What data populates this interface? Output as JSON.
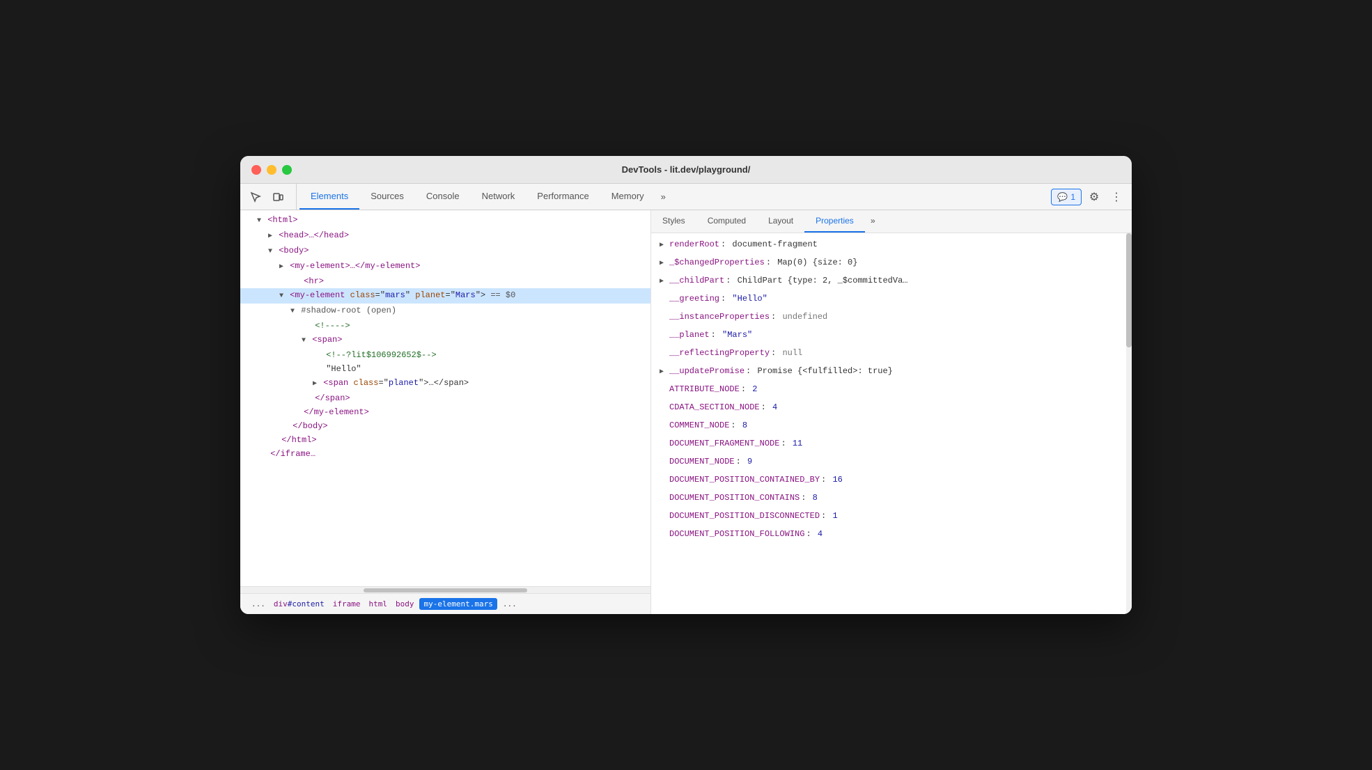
{
  "window": {
    "title": "DevTools - lit.dev/playground/"
  },
  "toolbar": {
    "tabs": [
      {
        "id": "elements",
        "label": "Elements",
        "active": true
      },
      {
        "id": "sources",
        "label": "Sources",
        "active": false
      },
      {
        "id": "console",
        "label": "Console",
        "active": false
      },
      {
        "id": "network",
        "label": "Network",
        "active": false
      },
      {
        "id": "performance",
        "label": "Performance",
        "active": false
      },
      {
        "id": "memory",
        "label": "Memory",
        "active": false
      }
    ],
    "more_tabs_icon": "»",
    "badge_icon": "💬",
    "badge_count": "1",
    "settings_icon": "⚙",
    "menu_icon": "⋮"
  },
  "props_panel": {
    "tabs": [
      {
        "id": "styles",
        "label": "Styles",
        "active": false
      },
      {
        "id": "computed",
        "label": "Computed",
        "active": false
      },
      {
        "id": "layout",
        "label": "Layout",
        "active": false
      },
      {
        "id": "properties",
        "label": "Properties",
        "active": true
      }
    ],
    "more_icon": "»",
    "properties": [
      {
        "expand": "▶",
        "key": "renderRoot",
        "colon": ":",
        "value": "document-fragment",
        "value_type": "object"
      },
      {
        "expand": "▶",
        "key": "_$changedProperties",
        "colon": ":",
        "value": "Map(0) {size: 0}",
        "value_type": "object"
      },
      {
        "expand": "▶",
        "key": "__childPart",
        "colon": ":",
        "value": "ChildPart {type: 2, _$committedVa…",
        "value_type": "object"
      },
      {
        "expand": "",
        "key": "__greeting",
        "colon": ":",
        "value": "\"Hello\"",
        "value_type": "string"
      },
      {
        "expand": "",
        "key": "__instanceProperties",
        "colon": ":",
        "value": "undefined",
        "value_type": "keyword"
      },
      {
        "expand": "",
        "key": "__planet",
        "colon": ":",
        "value": "\"Mars\"",
        "value_type": "string"
      },
      {
        "expand": "",
        "key": "__reflectingProperty",
        "colon": ":",
        "value": "null",
        "value_type": "null"
      },
      {
        "expand": "▶",
        "key": "__updatePromise",
        "colon": ":",
        "value": "Promise {<fulfilled>: true}",
        "value_type": "object"
      },
      {
        "expand": "",
        "key": "ATTRIBUTE_NODE",
        "colon": ":",
        "value": "2",
        "value_type": "number"
      },
      {
        "expand": "",
        "key": "CDATA_SECTION_NODE",
        "colon": ":",
        "value": "4",
        "value_type": "number"
      },
      {
        "expand": "",
        "key": "COMMENT_NODE",
        "colon": ":",
        "value": "8",
        "value_type": "number"
      },
      {
        "expand": "",
        "key": "DOCUMENT_FRAGMENT_NODE",
        "colon": ":",
        "value": "11",
        "value_type": "number"
      },
      {
        "expand": "",
        "key": "DOCUMENT_NODE",
        "colon": ":",
        "value": "9",
        "value_type": "number"
      },
      {
        "expand": "",
        "key": "DOCUMENT_POSITION_CONTAINED_BY",
        "colon": ":",
        "value": "16",
        "value_type": "number"
      },
      {
        "expand": "",
        "key": "DOCUMENT_POSITION_CONTAINS",
        "colon": ":",
        "value": "8",
        "value_type": "number"
      },
      {
        "expand": "",
        "key": "DOCUMENT_POSITION_DISCONNECTED",
        "colon": ":",
        "value": "1",
        "value_type": "number"
      },
      {
        "expand": "",
        "key": "DOCUMENT_POSITION_FOLLOWING",
        "colon": ":",
        "value": "4",
        "value_type": "number"
      }
    ]
  },
  "dom_tree": {
    "lines": [
      {
        "indent": 1,
        "content": "▼ <html>",
        "type": "tag"
      },
      {
        "indent": 2,
        "content": "▶ <head>…</head>",
        "type": "tag"
      },
      {
        "indent": 2,
        "content": "▼ <body>",
        "type": "tag"
      },
      {
        "indent": 3,
        "content": "▶ <my-element>…</my-element>",
        "type": "tag"
      },
      {
        "indent": 4,
        "content": "<hr>",
        "type": "tag"
      },
      {
        "indent": 3,
        "content": "▼ <my-element class=\"mars\" planet=\"Mars\"> == $0",
        "type": "selected"
      },
      {
        "indent": 4,
        "content": "▼ #shadow-root (open)",
        "type": "shadow"
      },
      {
        "indent": 5,
        "content": "<!---->",
        "type": "comment"
      },
      {
        "indent": 5,
        "content": "▼ <span>",
        "type": "tag"
      },
      {
        "indent": 6,
        "content": "<!--?lit$106992652$-->",
        "type": "comment"
      },
      {
        "indent": 6,
        "content": "\"Hello\"",
        "type": "text"
      },
      {
        "indent": 6,
        "content": "▶ <span class=\"planet\">…</span>",
        "type": "tag"
      },
      {
        "indent": 5,
        "content": "</span>",
        "type": "tag"
      },
      {
        "indent": 4,
        "content": "</my-element>",
        "type": "tag"
      },
      {
        "indent": 3,
        "content": "</body>",
        "type": "tag"
      },
      {
        "indent": 2,
        "content": "</html>",
        "type": "tag"
      },
      {
        "indent": 1,
        "content": "</iframe…",
        "type": "tag"
      }
    ]
  },
  "breadcrumb": {
    "items": [
      {
        "label": "...",
        "active": false
      },
      {
        "label": "div#content",
        "active": false
      },
      {
        "label": "iframe",
        "active": false
      },
      {
        "label": "html",
        "active": false
      },
      {
        "label": "body",
        "active": false
      },
      {
        "label": "my-element.mars",
        "active": true
      },
      {
        "label": "...",
        "active": false
      }
    ]
  },
  "colors": {
    "active_tab": "#1a73e8",
    "selected_row": "#cce5ff",
    "tag": "#881280",
    "attr_name": "#994500",
    "attr_value": "#1a1aa6",
    "comment": "#236e25"
  }
}
